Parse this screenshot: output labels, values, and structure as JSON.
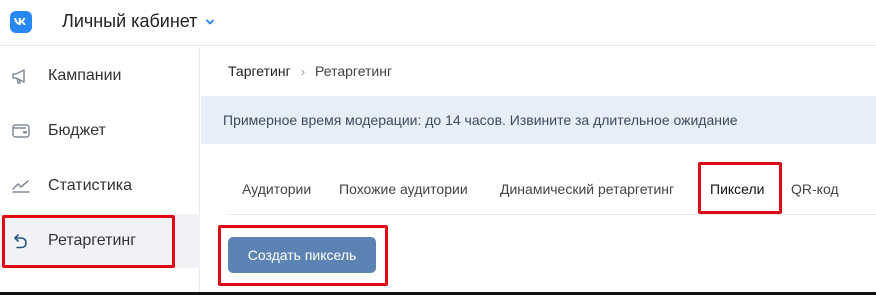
{
  "header": {
    "title": "Личный кабинет",
    "logo_icon": "vk-logo-icon",
    "chevron_icon": "chevron-down-icon"
  },
  "sidebar": {
    "items": [
      {
        "label": "Кампании",
        "icon": "megaphone-icon"
      },
      {
        "label": "Бюджет",
        "icon": "wallet-icon"
      },
      {
        "label": "Статистика",
        "icon": "chart-line-icon"
      },
      {
        "label": "Ретаргетинг",
        "icon": "retarget-arrow-icon",
        "active": true
      }
    ]
  },
  "breadcrumb": {
    "items": [
      "Таргетинг",
      "Ретаргетинг"
    ],
    "separator": "›"
  },
  "notice": {
    "text": "Примерное время модерации: до 14 часов. Извините за длительное ожидание"
  },
  "tabs": [
    {
      "label": "Аудитории"
    },
    {
      "label": "Похожие аудитории"
    },
    {
      "label": "Динамический ретаргетинг"
    },
    {
      "label": "Пиксели",
      "active": true
    },
    {
      "label": "QR-код"
    }
  ],
  "actions": {
    "create_pixel_label": "Создать пиксель"
  },
  "colors": {
    "brand": "#2787f5",
    "button": "#5b84b5",
    "notice_bg": "#e6eefa",
    "highlight": "#e30613"
  }
}
